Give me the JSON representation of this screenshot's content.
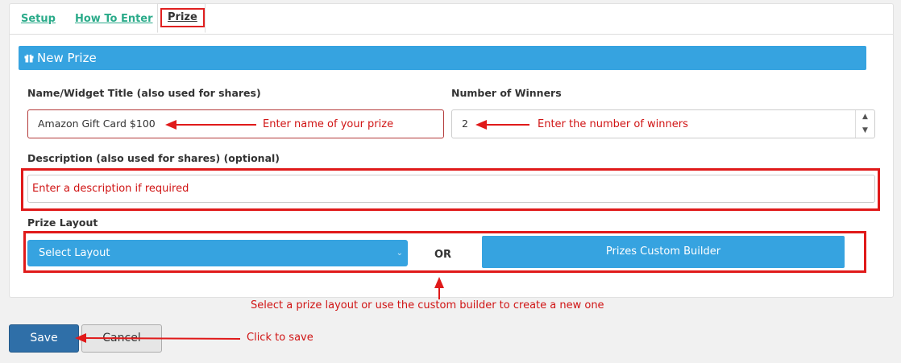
{
  "tabs": [
    {
      "label": "Setup"
    },
    {
      "label": "How To Enter"
    },
    {
      "label": "Prize"
    }
  ],
  "panel": {
    "title": "New Prize",
    "icon": "gift-icon"
  },
  "form": {
    "title_label": "Name/Widget Title (also used for shares)",
    "title_value": "Amazon Gift Card $100",
    "winners_label": "Number of Winners",
    "winners_value": "2",
    "description_label": "Description (also used for shares) (optional)",
    "description_placeholder": "Enter a description if required",
    "layout_label": "Prize Layout",
    "layout_select_value": "Select Layout",
    "or_text": "OR",
    "builder_button": "Prizes Custom Builder"
  },
  "annotations": {
    "title_hint": "Enter name of your prize",
    "winners_hint": "Enter the number of winners",
    "layout_hint": "Select a prize layout or use the custom builder to create a new one",
    "save_hint": "Click to save"
  },
  "actions": {
    "save": "Save",
    "cancel": "Cancel"
  },
  "colors": {
    "accent_blue": "#36a3e0",
    "annotation_red": "#e01a1a",
    "tab_green": "#2bab8a"
  }
}
